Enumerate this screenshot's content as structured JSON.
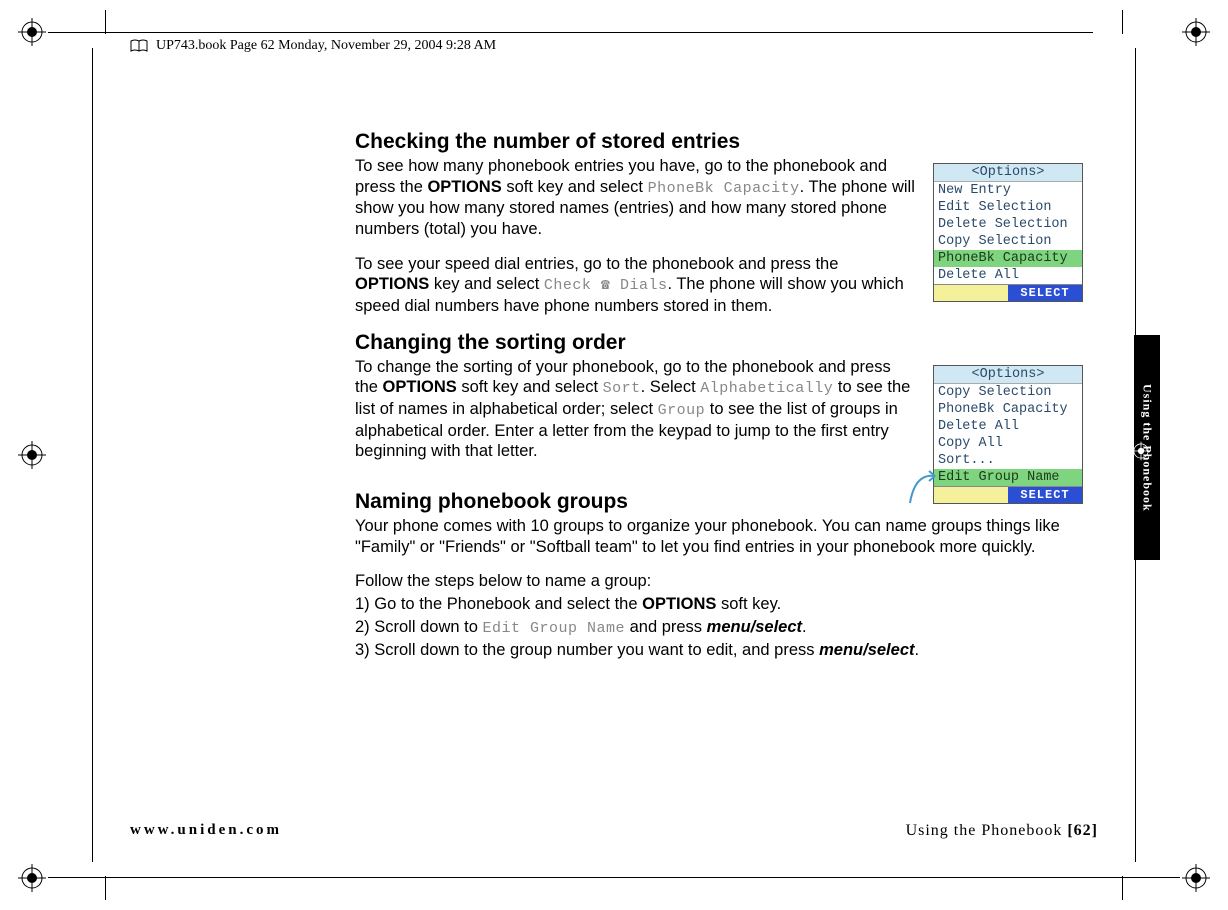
{
  "header": {
    "text": "UP743.book  Page 62  Monday, November 29, 2004  9:28 AM"
  },
  "sidetab": {
    "label": "Using the Phonebook"
  },
  "section1": {
    "heading": "Checking the number of stored entries",
    "p1_a": "To see how many phonebook entries you have, go to the phonebook and press the ",
    "p1_opt": "OPTIONS",
    "p1_b": " soft key and select ",
    "p1_m1": "PhoneBk Capacity",
    "p1_c": ". The phone will show you how many stored names (entries) and how many stored phone numbers (total) you have.",
    "p2_a": "To see your speed dial entries, go to the phonebook and press the ",
    "p2_opt": "OPTIONS",
    "p2_b": " key and select ",
    "p2_m1": "Check ☎ Dials",
    "p2_c": ". The phone will show you which speed dial numbers have phone numbers stored in them."
  },
  "section2": {
    "heading": "Changing the sorting order",
    "p1_a": "To change the sorting of your phonebook, go to the phonebook and press the ",
    "p1_opt": "OPTIONS",
    "p1_b": " soft key and select ",
    "p1_m1": "Sort",
    "p1_c": ". Select ",
    "p1_m2": "Alphabetically",
    "p1_d": " to see the list of names in alphabetical order; select ",
    "p1_m3": "Group",
    "p1_e": " to see the list of groups in alphabetical order. Enter a letter from the keypad to jump to the first entry beginning with that letter."
  },
  "section3": {
    "heading": "Naming phonebook groups",
    "p1": "Your phone comes with 10 groups to organize your phonebook. You can name groups things like \"Family\" or \"Friends\" or \"Softball team\" to let you find entries in your phonebook more quickly.",
    "p2": "Follow the steps below to name a group:",
    "s1_a": "1) Go to the Phonebook and select the ",
    "s1_opt": "OPTIONS",
    "s1_b": " soft key.",
    "s2_a": "2) Scroll down to ",
    "s2_m": "Edit Group Name",
    "s2_b": " and press ",
    "s2_ms": "menu/select",
    "s2_c": ".",
    "s3_a": "3) Scroll down to the group number you want to edit, and press ",
    "s3_ms": "menu/select",
    "s3_b": "."
  },
  "screen1": {
    "title": "<Options>",
    "rows": [
      "New Entry",
      "Edit Selection",
      "Delete Selection",
      "Copy Selection",
      "PhoneBk Capacity",
      "Delete All"
    ],
    "highlight_index": 4,
    "soft_right": "SELECT"
  },
  "screen2": {
    "title": "<Options>",
    "rows": [
      "Copy Selection",
      "PhoneBk Capacity",
      "Delete All",
      "Copy All",
      "Sort...",
      "Edit Group Name"
    ],
    "highlight_index": 5,
    "soft_right": "SELECT"
  },
  "footer": {
    "left": "www.uniden.com",
    "right_label": "Using the Phonebook ",
    "right_page": "[62]"
  }
}
